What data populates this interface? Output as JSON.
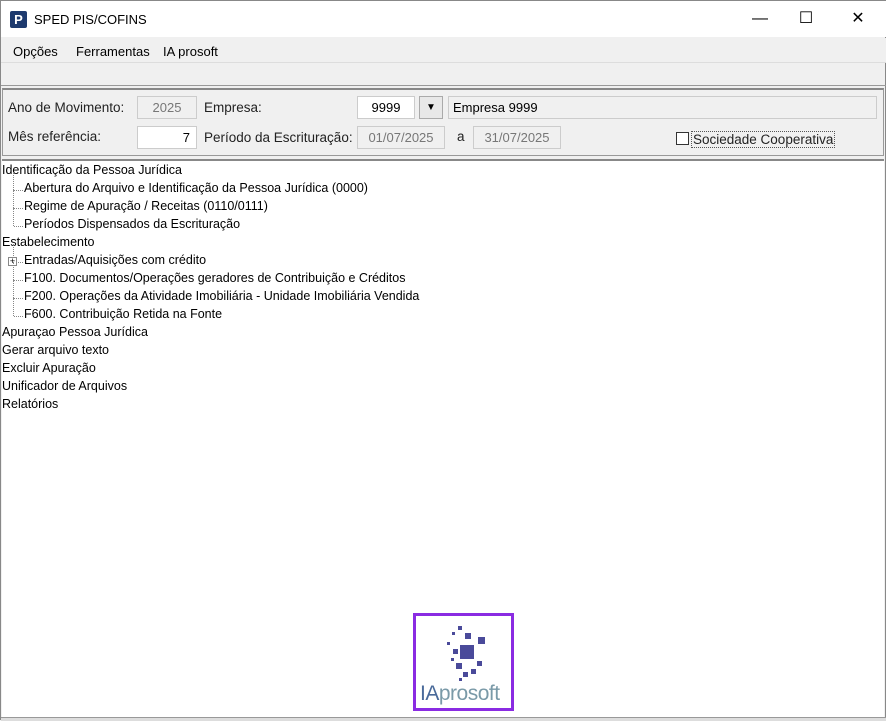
{
  "window": {
    "title": "SPED PIS/COFINS",
    "app_icon": "P",
    "minimize": "—",
    "maximize": "☐",
    "close": "✕"
  },
  "menu": [
    "Opções",
    "Ferramentas",
    "IA prosoft"
  ],
  "form": {
    "ano_label": "Ano de Movimento:",
    "ano_value": "2025",
    "empresa_label": "Empresa:",
    "empresa_code": "9999",
    "empresa_name": "Empresa 9999",
    "mes_label": "Mês referência:",
    "mes_value": "7",
    "periodo_label": "Período da Escrituração:",
    "periodo_inicio": "01/07/2025",
    "periodo_sep": "a",
    "periodo_fim": "31/07/2025",
    "cooperativa_label": "Sociedade Cooperativa",
    "cooperativa_checked": false
  },
  "tree": [
    {
      "label": "Identificação da Pessoa Jurídica",
      "level": 0
    },
    {
      "label": "Abertura do Arquivo e Identificação da Pessoa Jurídica (0000)",
      "level": 1
    },
    {
      "label": "Regime de Apuração / Receitas (0110/0111)",
      "level": 1
    },
    {
      "label": "Períodos Dispensados da Escrituração",
      "level": 1
    },
    {
      "label": "Estabelecimento",
      "level": 0
    },
    {
      "label": "Entradas/Aquisições com crédito",
      "level": 1,
      "expandable": true
    },
    {
      "label": "F100. Documentos/Operações geradores de Contribuição e Créditos",
      "level": 1
    },
    {
      "label": "F200. Operações da Atividade Imobiliária - Unidade Imobiliária Vendida",
      "level": 1
    },
    {
      "label": "F600. Contribuição Retida na Fonte",
      "level": 1
    },
    {
      "label": "Apuraçao Pessoa Jurídica",
      "level": 0
    },
    {
      "label": "Gerar arquivo texto",
      "level": 0
    },
    {
      "label": "Excluir Apuração",
      "level": 0
    },
    {
      "label": "Unificador de Arquivos",
      "level": 0
    },
    {
      "label": "Relatórios",
      "level": 0
    }
  ],
  "logo": {
    "text_ia": "IA",
    "text_rest": "prosoft"
  }
}
